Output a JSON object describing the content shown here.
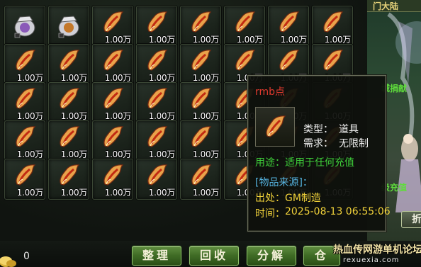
{
  "inventory": {
    "quantity_label": "1.00万",
    "slots": [
      {
        "kind": "bag",
        "color": "#8a5ab8",
        "qty": ""
      },
      {
        "kind": "bag",
        "color": "#c4782a",
        "qty": ""
      },
      {
        "kind": "scroll",
        "qty": "1.00万"
      },
      {
        "kind": "scroll",
        "qty": "1.00万"
      },
      {
        "kind": "scroll",
        "qty": "1.00万"
      },
      {
        "kind": "scroll",
        "qty": "1.00万"
      },
      {
        "kind": "scroll",
        "qty": "1.00万"
      },
      {
        "kind": "scroll",
        "qty": "1.00万"
      },
      {
        "kind": "scroll",
        "qty": "1.00万"
      },
      {
        "kind": "scroll",
        "qty": "1.00万"
      },
      {
        "kind": "scroll",
        "qty": "1.00万"
      },
      {
        "kind": "scroll",
        "qty": "1.00万"
      },
      {
        "kind": "scroll",
        "qty": "1.00万"
      },
      {
        "kind": "scroll",
        "qty": "1.00万"
      },
      {
        "kind": "scroll",
        "qty": "1.00万"
      },
      {
        "kind": "scroll",
        "qty": "1.00万"
      },
      {
        "kind": "scroll",
        "qty": "1.00万"
      },
      {
        "kind": "scroll",
        "qty": "1.00万"
      },
      {
        "kind": "scroll",
        "qty": "1.00万"
      },
      {
        "kind": "scroll",
        "qty": "1.00万"
      },
      {
        "kind": "scroll",
        "qty": "1.00万"
      },
      {
        "kind": "scroll",
        "qty": "1.00万"
      },
      {
        "kind": "scroll",
        "qty": "1.00万"
      },
      {
        "kind": "scroll",
        "qty": "1.00万"
      },
      {
        "kind": "scroll",
        "qty": "1.00万"
      },
      {
        "kind": "scroll",
        "qty": "1.00万"
      },
      {
        "kind": "scroll",
        "qty": "1.00万"
      },
      {
        "kind": "scroll",
        "qty": "1.00万"
      },
      {
        "kind": "scroll",
        "qty": "1.00万"
      },
      {
        "kind": "scroll",
        "qty": "1.00万"
      },
      {
        "kind": "scroll",
        "qty": "1.00万"
      },
      {
        "kind": "scroll",
        "qty": "1.00万"
      },
      {
        "kind": "scroll",
        "qty": "1.00万"
      },
      {
        "kind": "scroll",
        "qty": "1.00万"
      },
      {
        "kind": "scroll",
        "qty": "1.00万"
      },
      {
        "kind": "scroll",
        "qty": "1.00万"
      },
      {
        "kind": "scroll",
        "qty": "1.00万"
      },
      {
        "kind": "scroll",
        "qty": "1.00万"
      },
      {
        "kind": "scroll",
        "qty": "1.00万"
      },
      {
        "kind": "scroll",
        "qty": "1.00万"
      }
    ],
    "icon": "red-paper-scroll-icon"
  },
  "bottom_bar": {
    "gold_icon": "gold-coin-icon",
    "gold_amount": "0",
    "buttons": {
      "sort": "整理",
      "recycle": "回收",
      "decompose": "分解",
      "warehouse": "仓"
    }
  },
  "tooltip": {
    "item_name": "rmb点",
    "type_label": "类型：",
    "type_value": "道具",
    "require_label": "需求：",
    "require_value": "无限制",
    "use_label": "用途：",
    "use_value": "适用于任何充值",
    "source_title": "[物品来源]：",
    "origin_label": "出处：",
    "origin_value": "GM制造",
    "time_label": "时间：",
    "time_value": "2025-08-13 06:55:06",
    "colors": {
      "name": "#e03a2e",
      "use": "#3fd03a",
      "source": "#55b3e0",
      "origin": "#f1d23a"
    }
  },
  "scene": {
    "title_fragment": "门大陆",
    "green_text_1": "城捐献",
    "green_text_2": "级充值",
    "side_button": "折"
  },
  "watermark": {
    "title": "热血传网游单机论坛",
    "url": "rexuexia.com"
  }
}
